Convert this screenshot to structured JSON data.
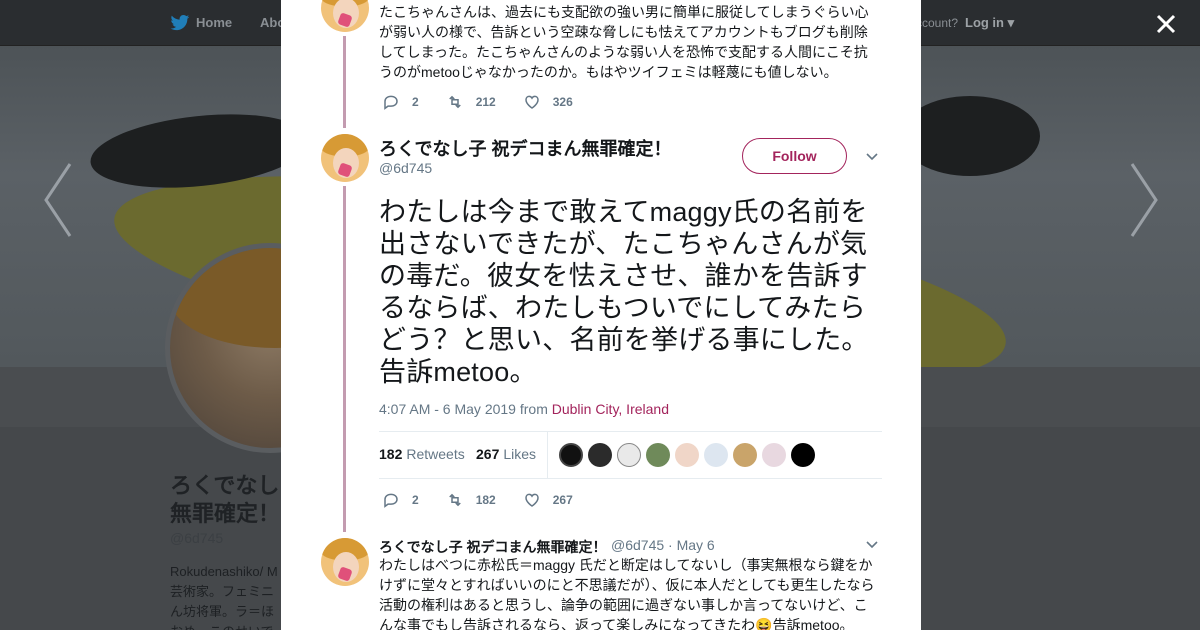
{
  "nav": {
    "home": "Home",
    "about": "Abo",
    "account_prompt": "ccount?",
    "login": "Log in"
  },
  "background_profile": {
    "name": "ろくでなし\n無罪確定！",
    "handle": "@6d745",
    "bio": "Rokudenashiko/ M 芸術家。フェミニ ん坊将軍。ラ＝ほ おめーこのせいで"
  },
  "prev_tweet": {
    "text": "たこちゃんさんは、過去にも支配欲の強い男に簡単に服従してしまうぐらい心が弱い人の様で、告訴という空疎な脅しにも怯えてアカウントもブログも削除してしまった。たこちゃんさんのような弱い人を恐怖で支配する人間にこそ抗うのがmetooじゃなかったのか。もはやツイフェミは軽蔑にも値しない。",
    "replies": "2",
    "retweets": "212",
    "likes": "326"
  },
  "main_tweet": {
    "name": "ろくでなし子 祝デコまん無罪確定！",
    "handle": "@6d745",
    "follow_label": "Follow",
    "text": "わたしは今まで敢えてmaggy氏の名前を出さないできたが、たこちゃんさんが気の毒だ。彼女を怯えさせ、誰かを告訴するならば、わたしもついでにしてみたらどう？と思い、名前を挙げる事にした。告訴metoo。",
    "timestamp": "4:07 AM - 6 May 2019 from ",
    "location": "Dublin City, Ireland",
    "retweet_count": "182",
    "retweet_label": "Retweets",
    "like_count": "267",
    "like_label": "Likes",
    "replies": "2",
    "retweets": "182",
    "likes": "267"
  },
  "reply_tweet": {
    "name": "ろくでなし子 祝デコまん無罪確定！",
    "handle": "@6d745",
    "date": "· May 6",
    "text": "わたしはべつに赤松氏＝maggy 氏だと断定はしてないし（事実無根なら鍵をかけずに堂々とすればいいのにと不思議だが）、仮に本人だとしても更生したなら活動の権利はあると思うし、論争の範囲に過ぎない事しか言ってないけど、こんな事でもし告訴されるなら、返って楽しみになってきたわ😆告訴metoo。"
  },
  "colors": {
    "accent": "#a3245c",
    "thread": "#c39bb0",
    "muted": "#657786"
  }
}
